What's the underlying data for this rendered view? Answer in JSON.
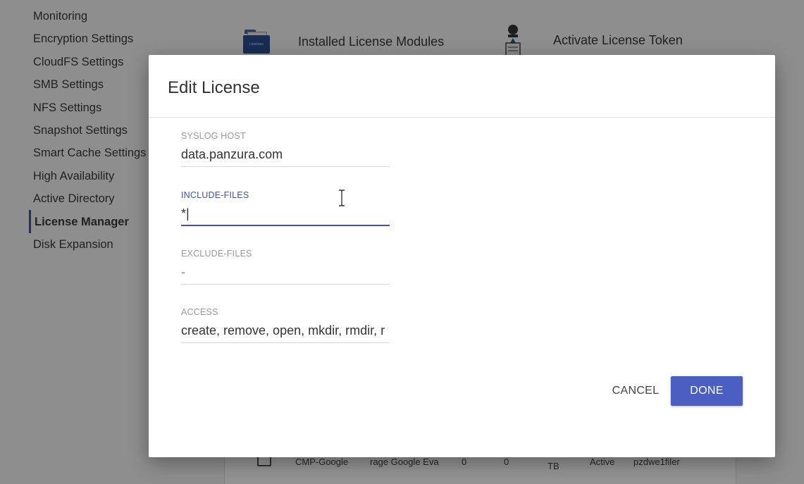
{
  "sidebar": {
    "items": [
      {
        "label": "Monitoring"
      },
      {
        "label": "Encryption Settings"
      },
      {
        "label": "CloudFS Settings"
      },
      {
        "label": "SMB Settings"
      },
      {
        "label": "NFS Settings"
      },
      {
        "label": "Snapshot Settings"
      },
      {
        "label": "Smart Cache Settings"
      },
      {
        "label": "High Availability"
      },
      {
        "label": "Active Directory"
      },
      {
        "label": "License Manager"
      },
      {
        "label": "Disk Expansion"
      }
    ],
    "active_item": "License Manager"
  },
  "modules": {
    "installed": {
      "label": "Installed License Modules",
      "icon_text": "Licenses"
    },
    "activate": {
      "label": "Activate License Token"
    }
  },
  "background_table": {
    "row": [
      "CMP-Google",
      "rage Google Eva",
      "0",
      "0",
      "TB",
      "Active",
      "pzdwe1filer"
    ]
  },
  "dialog": {
    "title": "Edit License",
    "fields": {
      "syslog_host": {
        "label": "SYSLOG HOST",
        "value": "data.panzura.com"
      },
      "include_files": {
        "label": "INCLUDE-FILES",
        "value": "*|"
      },
      "exclude_files": {
        "label": "EXCLUDE-FILES",
        "value": "-"
      },
      "access": {
        "label": "ACCESS",
        "value": "create, remove, open, mkdir, rmdir, r"
      }
    },
    "cancel_label": "CANCEL",
    "done_label": "DONE"
  },
  "colors": {
    "accent": "#3f51b5",
    "done_button": "#4a5fc1",
    "overlay": "rgba(0,0,0,0.42)"
  }
}
